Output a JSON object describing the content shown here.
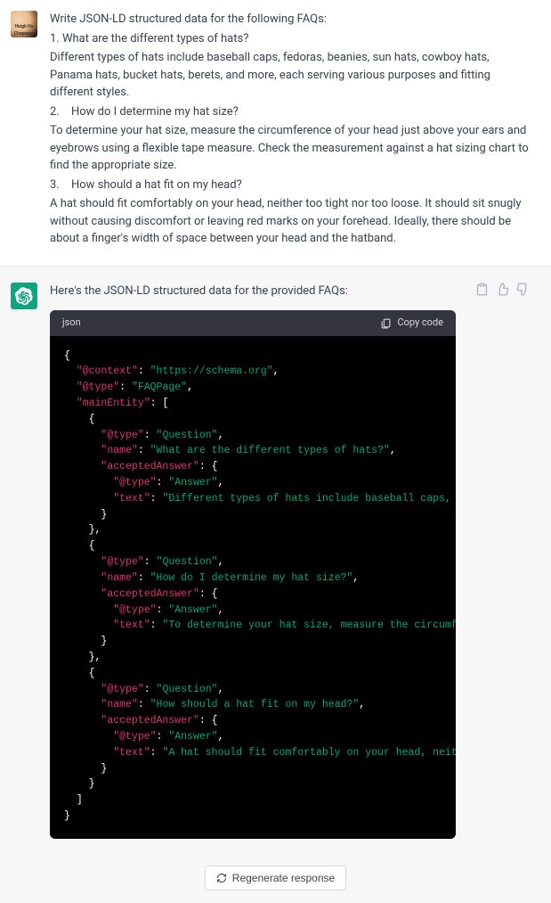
{
  "user": {
    "avatar_label": "Heigh Ho Chapeaux",
    "prompt_lines": [
      "Write JSON-LD structured data for the following FAQs:",
      "1. What are the different types of hats?",
      "Different types of hats include baseball caps, fedoras, beanies, sun hats, cowboy hats, Panama hats, bucket hats, berets, and more, each serving various purposes and fitting different styles.",
      "2. How do I determine my hat size?",
      "To determine your hat size, measure the circumference of your head just above your ears and eyebrows using a flexible tape measure. Check the measurement against a hat sizing chart to find the appropriate size.",
      "3. How should a hat fit on my head?",
      "A hat should fit comfortably on your head, neither too tight nor too loose. It should sit snugly without causing discomfort or leaving red marks on your forehead. Ideally, there should be about a finger's width of space between your head and the hatband."
    ]
  },
  "assistant": {
    "intro": "Here's the JSON-LD structured data for the provided FAQs:",
    "code_lang": "json",
    "copy_label": "Copy code",
    "code": {
      "context_key": "\"@context\"",
      "context_val": "\"https://schema.org\"",
      "type_key": "\"@type\"",
      "type_val": "\"FAQPage\"",
      "main_key": "\"mainEntity\"",
      "q_type_key": "\"@type\"",
      "q_type_val": "\"Question\"",
      "name_key": "\"name\"",
      "accepted_key": "\"acceptedAnswer\"",
      "a_type_key": "\"@type\"",
      "a_type_val": "\"Answer\"",
      "text_key": "\"text\"",
      "q1_name": "\"What are the different types of hats?\"",
      "q1_text": "\"Different types of hats include baseball caps, fedoras, bea",
      "q2_name": "\"How do I determine my hat size?\"",
      "q2_text": "\"To determine your hat size, measure the circumference of yo",
      "q3_name": "\"How should a hat fit on my head?\"",
      "q3_text": "\"A hat should fit comfortably on your head, neither too tigh"
    }
  },
  "footer": {
    "regenerate": "Regenerate response"
  }
}
